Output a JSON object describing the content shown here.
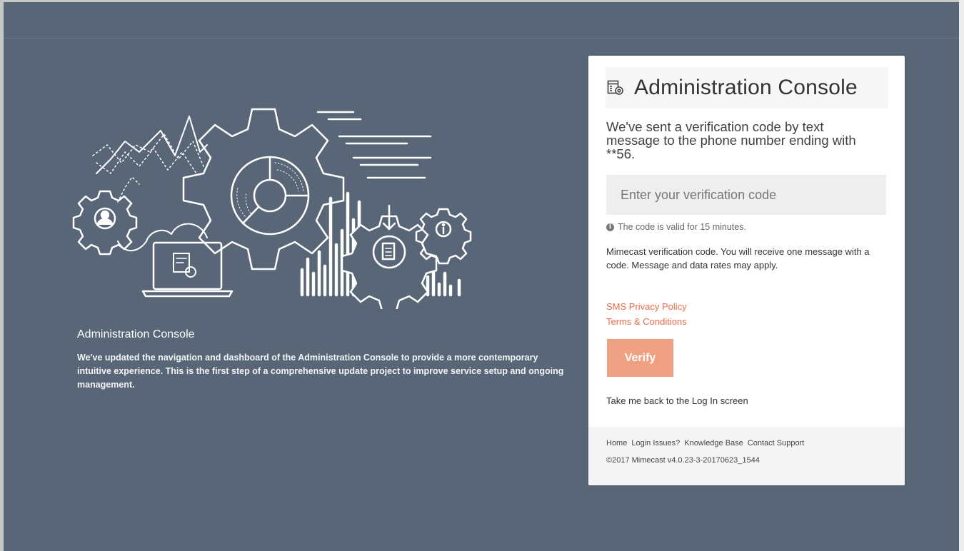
{
  "hero": {
    "title": "Administration Console",
    "description": "We've updated the navigation and dashboard of the Administration Console to provide a more contemporary intuitive experience. This is the first step of a comprehensive update project to improve service setup and ongoing management."
  },
  "card": {
    "title": "Administration Console",
    "icon": "admin-console-icon",
    "lead": "We've sent a verification code by text message to the phone number ending with **56.",
    "code_placeholder": "Enter your verification code",
    "validity_note": "The code is valid for 15 minutes.",
    "notice": "Mimecast verification code. You will receive one message with a code. Message and data rates may apply.",
    "sms_privacy_link": "SMS Privacy Policy",
    "terms_link": "Terms & Conditions",
    "verify_button": "Verify",
    "back_link": "Take me back to the Log In screen"
  },
  "footer": {
    "links": [
      "Home",
      "Login Issues?",
      "Knowledge Base",
      "Contact Support"
    ],
    "copyright": "©2017 Mimecast v4.0.23-3-20170623_1544"
  },
  "colors": {
    "background": "#586677",
    "accent": "#ee6a4c",
    "button": "#f0a184"
  }
}
